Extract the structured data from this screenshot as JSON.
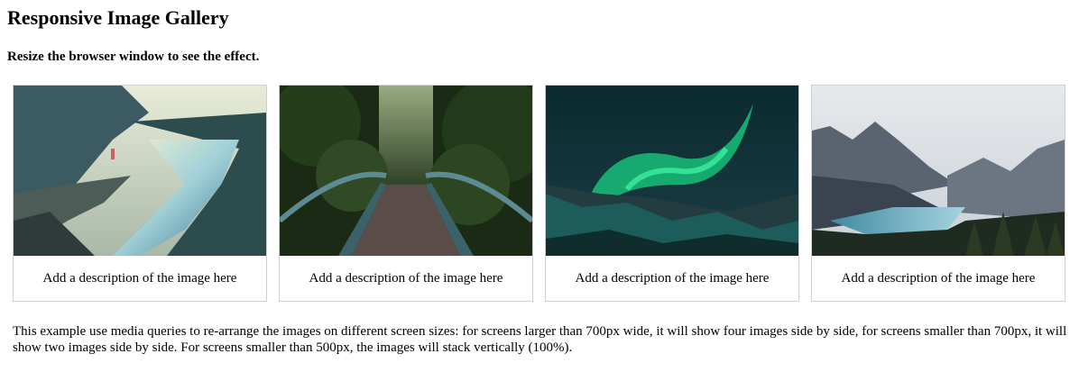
{
  "page": {
    "title": "Responsive Image Gallery",
    "subtitle": "Resize the browser window to see the effect.",
    "note": "This example use media queries to re-arrange the images on different screen sizes: for screens larger than 700px wide, it will show four images side by side, for screens smaller than 700px, it will show two images side by side. For screens smaller than 500px, the images will stack vertically (100%)."
  },
  "gallery": {
    "items": [
      {
        "icon": "fjord-cliff-image",
        "description": "Add a description of the image here"
      },
      {
        "icon": "forest-bridge-image",
        "description": "Add a description of the image here"
      },
      {
        "icon": "northern-lights-image",
        "description": "Add a description of the image here"
      },
      {
        "icon": "mountain-lake-image",
        "description": "Add a description of the image here"
      }
    ]
  }
}
